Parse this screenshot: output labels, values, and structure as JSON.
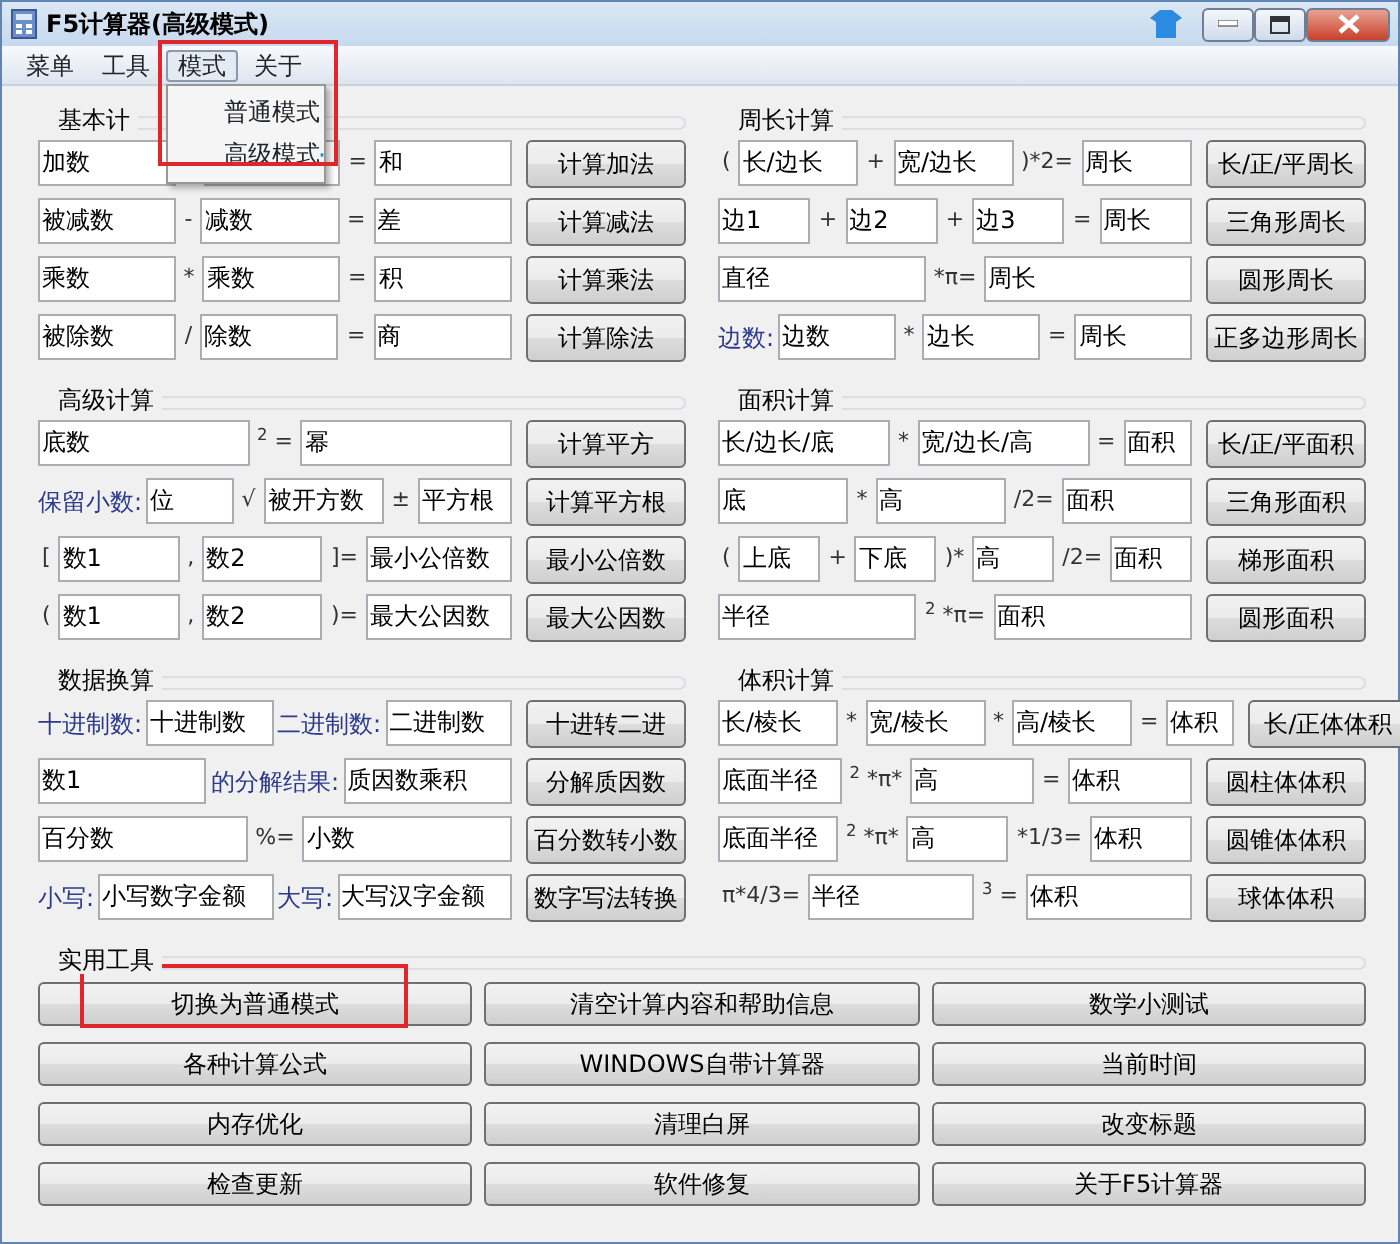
{
  "window": {
    "title": "F5计算器(高级模式)"
  },
  "menu": [
    {
      "label": "菜单",
      "expanded": false,
      "annotated": false
    },
    {
      "label": "工具",
      "expanded": false,
      "annotated": false
    },
    {
      "label": "模式",
      "expanded": true,
      "annotated": true,
      "items": [
        "普通模式",
        "高级模式"
      ]
    },
    {
      "label": "关于",
      "expanded": false,
      "annotated": false
    }
  ],
  "sections": [
    {
      "title": "基本计",
      "rows": [
        {
          "items": [
            {
              "kind": "field",
              "text": "加数"
            },
            {
              "kind": "op"
            },
            {
              "kind": "field"
            },
            {
              "kind": "op",
              "text": "="
            },
            {
              "kind": "field",
              "text": "和"
            }
          ],
          "button": "计算加法"
        },
        {
          "items": [
            {
              "kind": "field",
              "text": "被减数"
            },
            {
              "kind": "op",
              "text": "-"
            },
            {
              "kind": "field",
              "text": "减数"
            },
            {
              "kind": "op",
              "text": "="
            },
            {
              "kind": "field",
              "text": "差"
            }
          ],
          "button": "计算减法"
        },
        {
          "items": [
            {
              "kind": "field",
              "text": "乘数"
            },
            {
              "kind": "op",
              "text": "*"
            },
            {
              "kind": "field",
              "text": "乘数"
            },
            {
              "kind": "op",
              "text": "="
            },
            {
              "kind": "field",
              "text": "积"
            }
          ],
          "button": "计算乘法"
        },
        {
          "items": [
            {
              "kind": "field",
              "text": "被除数"
            },
            {
              "kind": "op",
              "text": "/"
            },
            {
              "kind": "field",
              "text": "除数"
            },
            {
              "kind": "op",
              "text": "="
            },
            {
              "kind": "field",
              "text": "商"
            }
          ],
          "button": "计算除法"
        }
      ]
    },
    {
      "title": "周长计算",
      "rows": [
        {
          "items": [
            {
              "kind": "op",
              "text": "("
            },
            {
              "kind": "field",
              "text": "长/边长"
            },
            {
              "kind": "op",
              "text": "+"
            },
            {
              "kind": "field",
              "text": "宽/边长"
            },
            {
              "kind": "op",
              "text": ")*2="
            },
            {
              "kind": "field",
              "text": "周长"
            }
          ],
          "button": "长/正/平周长"
        },
        {
          "items": [
            {
              "kind": "field",
              "text": "边1"
            },
            {
              "kind": "op",
              "text": "+"
            },
            {
              "kind": "field",
              "text": "边2"
            },
            {
              "kind": "op",
              "text": "+"
            },
            {
              "kind": "field",
              "text": "边3"
            },
            {
              "kind": "op",
              "text": "="
            },
            {
              "kind": "field",
              "text": "周长"
            }
          ],
          "button": "三角形周长"
        },
        {
          "items": [
            {
              "kind": "field",
              "text": "直径"
            },
            {
              "kind": "op",
              "text": "*π="
            },
            {
              "kind": "field",
              "text": "周长"
            }
          ],
          "button": "圆形周长"
        },
        {
          "items": [
            {
              "kind": "label",
              "text": "边数:"
            },
            {
              "kind": "field",
              "text": "边数"
            },
            {
              "kind": "op",
              "text": "*"
            },
            {
              "kind": "field",
              "text": "边长"
            },
            {
              "kind": "op",
              "text": "="
            },
            {
              "kind": "field",
              "text": "周长"
            }
          ],
          "button": "正多边形周长"
        }
      ]
    },
    {
      "title": "高级计算",
      "rows": [
        {
          "items": [
            {
              "kind": "field",
              "text": "底数"
            },
            {
              "kind": "op",
              "sup": "2",
              "text": "="
            },
            {
              "kind": "field",
              "text": "幂"
            }
          ],
          "button": "计算平方"
        },
        {
          "items": [
            {
              "kind": "label",
              "text": "保留小数:"
            },
            {
              "kind": "field",
              "text": "位"
            },
            {
              "kind": "op",
              "text": "√"
            },
            {
              "kind": "field",
              "text": "被开方数"
            },
            {
              "kind": "op",
              "text": "±"
            },
            {
              "kind": "field",
              "text": "平方根"
            }
          ],
          "button": "计算平方根"
        },
        {
          "items": [
            {
              "kind": "op",
              "text": "["
            },
            {
              "kind": "field",
              "text": "数1"
            },
            {
              "kind": "op",
              "text": ","
            },
            {
              "kind": "field",
              "text": "数2"
            },
            {
              "kind": "op",
              "text": "]="
            },
            {
              "kind": "field",
              "text": "最小公倍数"
            }
          ],
          "button": "最小公倍数"
        },
        {
          "items": [
            {
              "kind": "op",
              "text": "("
            },
            {
              "kind": "field",
              "text": "数1"
            },
            {
              "kind": "op",
              "text": ","
            },
            {
              "kind": "field",
              "text": "数2"
            },
            {
              "kind": "op",
              "text": ")="
            },
            {
              "kind": "field",
              "text": "最大公因数"
            }
          ],
          "button": "最大公因数"
        }
      ]
    },
    {
      "title": "面积计算",
      "rows": [
        {
          "items": [
            {
              "kind": "field",
              "text": "长/边长/底"
            },
            {
              "kind": "op",
              "text": "*"
            },
            {
              "kind": "field",
              "text": "宽/边长/高"
            },
            {
              "kind": "op",
              "text": "="
            },
            {
              "kind": "field",
              "text": "面积"
            }
          ],
          "button": "长/正/平面积"
        },
        {
          "items": [
            {
              "kind": "field",
              "text": "底"
            },
            {
              "kind": "op",
              "text": "*"
            },
            {
              "kind": "field",
              "text": "高"
            },
            {
              "kind": "op",
              "text": "/2="
            },
            {
              "kind": "field",
              "text": "面积"
            }
          ],
          "button": "三角形面积"
        },
        {
          "items": [
            {
              "kind": "op",
              "text": "("
            },
            {
              "kind": "field",
              "text": "上底"
            },
            {
              "kind": "op",
              "text": "+"
            },
            {
              "kind": "field",
              "text": "下底"
            },
            {
              "kind": "op",
              "text": ")*"
            },
            {
              "kind": "field",
              "text": "高"
            },
            {
              "kind": "op",
              "text": "/2="
            },
            {
              "kind": "field",
              "text": "面积"
            }
          ],
          "button": "梯形面积"
        },
        {
          "items": [
            {
              "kind": "field",
              "text": "半径"
            },
            {
              "kind": "op",
              "sup": "2",
              "text": "*π="
            },
            {
              "kind": "field",
              "text": "面积"
            }
          ],
          "button": "圆形面积"
        }
      ]
    },
    {
      "title": "数据换算",
      "rows": [
        {
          "items": [
            {
              "kind": "label",
              "text": "十进制数:"
            },
            {
              "kind": "field",
              "text": "十进制数"
            },
            {
              "kind": "label",
              "text": "二进制数:"
            },
            {
              "kind": "field",
              "text": "二进制数"
            }
          ],
          "button": "十进转二进"
        },
        {
          "items": [
            {
              "kind": "field",
              "text": "数1"
            },
            {
              "kind": "label",
              "text": "的分解结果:"
            },
            {
              "kind": "field",
              "text": "质因数乘积"
            }
          ],
          "button": "分解质因数"
        },
        {
          "items": [
            {
              "kind": "field",
              "text": "百分数"
            },
            {
              "kind": "op",
              "text": "%="
            },
            {
              "kind": "field",
              "text": "小数"
            }
          ],
          "button": "百分数转小数"
        },
        {
          "items": [
            {
              "kind": "label",
              "text": "小写:"
            },
            {
              "kind": "field",
              "text": "小写数字金额"
            },
            {
              "kind": "label",
              "text": "大写:"
            },
            {
              "kind": "field",
              "text": "大写汉字金额"
            }
          ],
          "button": "数字写法转换"
        }
      ]
    },
    {
      "title": "体积计算",
      "rows": [
        {
          "items": [
            {
              "kind": "field",
              "text": "长/棱长"
            },
            {
              "kind": "op",
              "text": "*"
            },
            {
              "kind": "field",
              "text": "宽/棱长"
            },
            {
              "kind": "op",
              "text": "*"
            },
            {
              "kind": "field",
              "text": "高/棱长"
            },
            {
              "kind": "op",
              "text": "="
            },
            {
              "kind": "field",
              "text": "体积"
            }
          ],
          "button": "长/正体体积"
        },
        {
          "items": [
            {
              "kind": "field",
              "text": "底面半径"
            },
            {
              "kind": "op",
              "sup": "2",
              "text": "*π*"
            },
            {
              "kind": "field",
              "text": "高"
            },
            {
              "kind": "op",
              "text": "="
            },
            {
              "kind": "field",
              "text": "体积"
            }
          ],
          "button": "圆柱体体积"
        },
        {
          "items": [
            {
              "kind": "field",
              "text": "底面半径"
            },
            {
              "kind": "op",
              "sup": "2",
              "text": "*π*"
            },
            {
              "kind": "field",
              "text": "高"
            },
            {
              "kind": "op",
              "text": "*1/3="
            },
            {
              "kind": "field",
              "text": "体积"
            }
          ],
          "button": "圆锥体体积"
        },
        {
          "items": [
            {
              "kind": "op",
              "text": "π*4/3="
            },
            {
              "kind": "field",
              "text": "半径"
            },
            {
              "kind": "op",
              "sup": "3",
              "text": "="
            },
            {
              "kind": "field",
              "text": "体积"
            }
          ],
          "button": "球体体积"
        }
      ]
    }
  ],
  "tools": {
    "title": "实用工具",
    "buttons": [
      {
        "label": "切换为普通模式",
        "annotated": true
      },
      {
        "label": "清空计算内容和帮助信息",
        "annotated": false
      },
      {
        "label": "数学小测试",
        "annotated": false
      },
      {
        "label": "各种计算公式",
        "annotated": false
      },
      {
        "label": "WINDOWS自带计算器",
        "annotated": false
      },
      {
        "label": "当前时间",
        "annotated": false
      },
      {
        "label": "内存优化",
        "annotated": false
      },
      {
        "label": "清理白屏",
        "annotated": false
      },
      {
        "label": "改变标题",
        "annotated": false
      },
      {
        "label": "检查更新",
        "annotated": false
      },
      {
        "label": "软件修复",
        "annotated": false
      },
      {
        "label": "关于F5计算器",
        "annotated": false
      }
    ]
  }
}
